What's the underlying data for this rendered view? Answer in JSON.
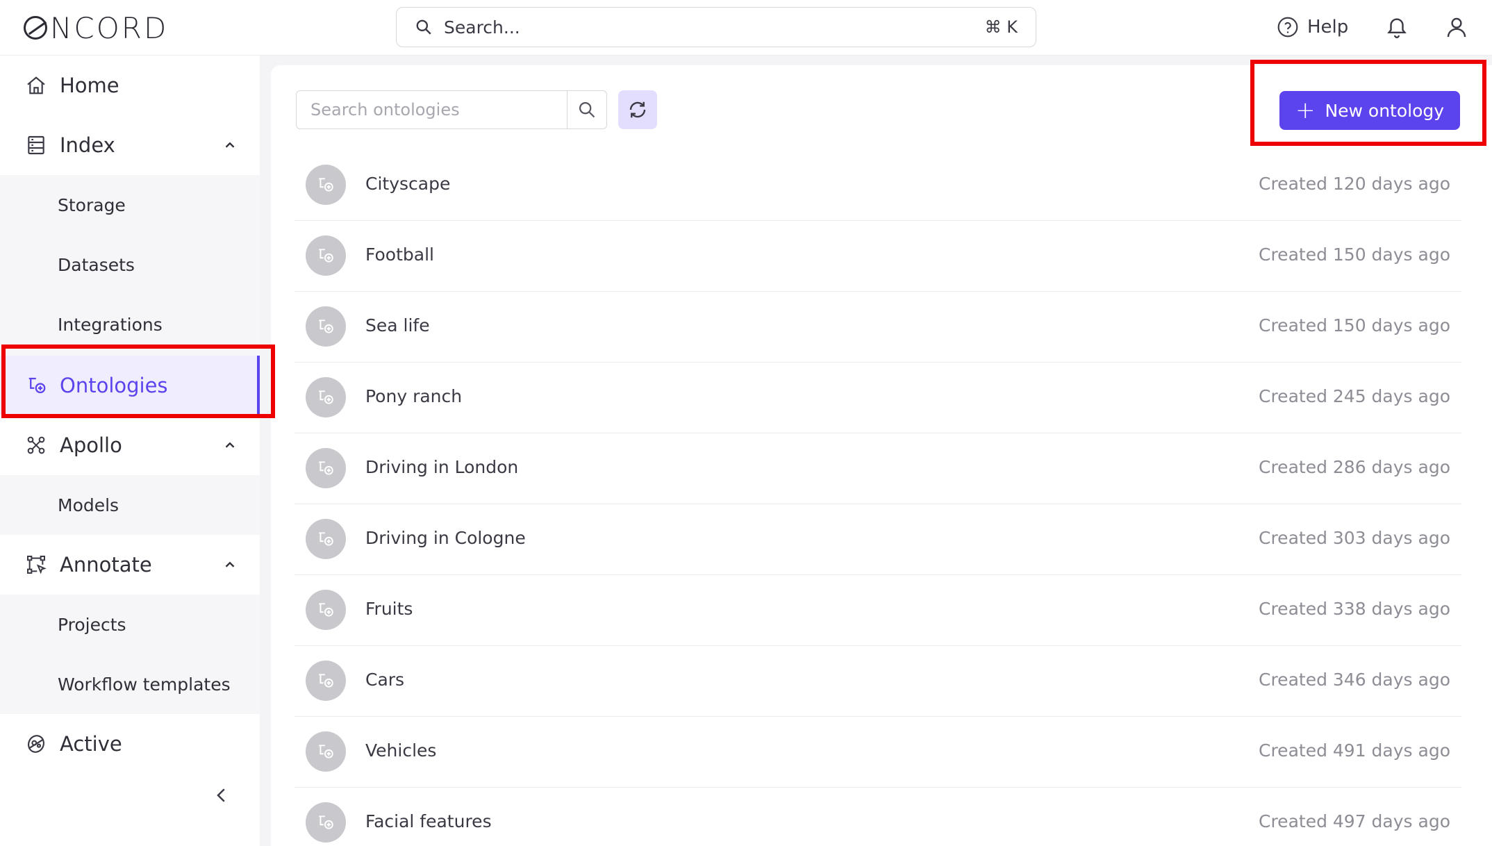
{
  "brand": {
    "logo_text": "NCORD"
  },
  "topbar": {
    "search_placeholder": "Search...",
    "search_shortcut": "⌘ K",
    "help_label": "Help",
    "icons": [
      "search-icon",
      "help-circle-icon",
      "bell-icon",
      "user-icon"
    ]
  },
  "sidebar": {
    "home": "Home",
    "index": "Index",
    "index_items": [
      "Storage",
      "Datasets",
      "Integrations",
      "Ontologies"
    ],
    "apollo": "Apollo",
    "apollo_items": [
      "Models"
    ],
    "annotate": "Annotate",
    "annotate_items": [
      "Projects",
      "Workflow templates"
    ],
    "active": "Active",
    "active_item": "Ontologies"
  },
  "main": {
    "search_placeholder": "Search ontologies",
    "new_button_label": "New ontology",
    "accent_color": "#5b43ee",
    "ontologies": [
      {
        "name": "Cityscape",
        "created": "Created 120 days ago"
      },
      {
        "name": "Football",
        "created": "Created 150 days ago"
      },
      {
        "name": "Sea life",
        "created": "Created 150 days ago"
      },
      {
        "name": "Pony ranch",
        "created": "Created 245 days ago"
      },
      {
        "name": "Driving in London",
        "created": "Created 286 days ago"
      },
      {
        "name": "Driving in Cologne",
        "created": "Created 303 days ago"
      },
      {
        "name": "Fruits",
        "created": "Created 338 days ago"
      },
      {
        "name": "Cars",
        "created": "Created 346 days ago"
      },
      {
        "name": "Vehicles",
        "created": "Created 491 days ago"
      },
      {
        "name": "Facial features",
        "created": "Created 497 days ago"
      }
    ]
  }
}
